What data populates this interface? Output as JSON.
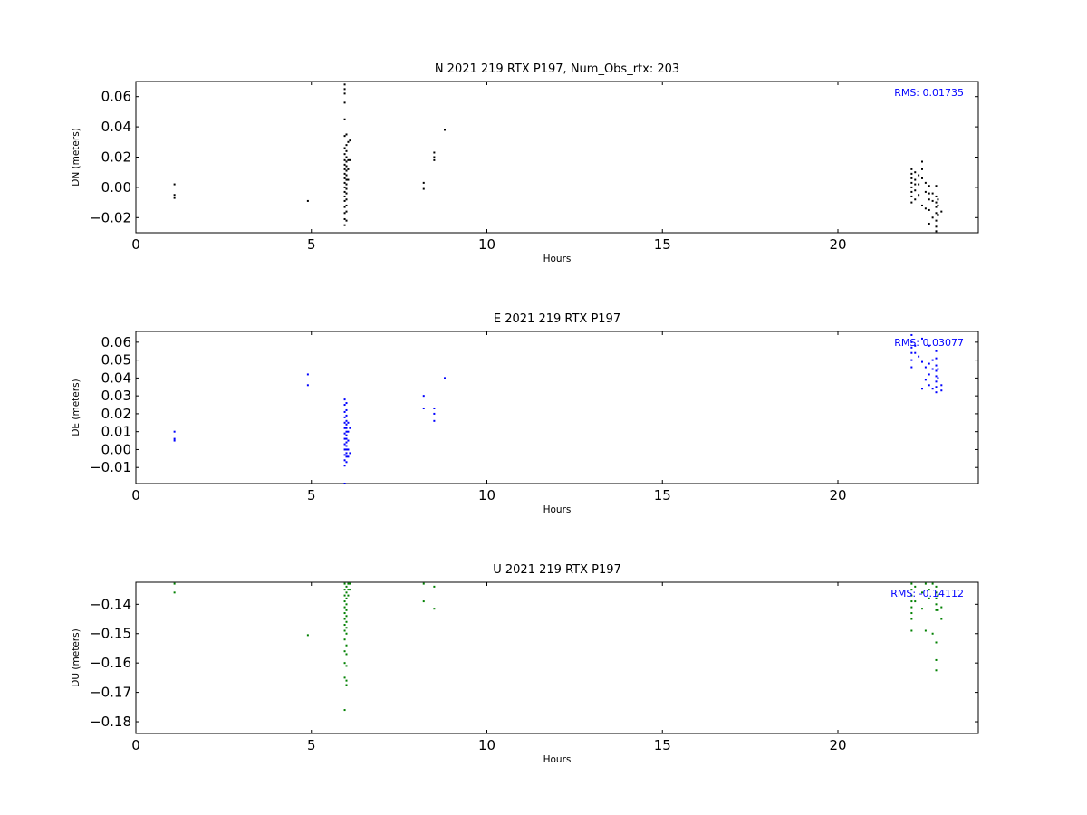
{
  "chart_data": [
    {
      "type": "scatter",
      "title": "N 2021 219 RTX  P197, Num_Obs_rtx: 203",
      "xlabel": "Hours",
      "ylabel": "DN (meters)",
      "xlim": [
        0,
        24
      ],
      "ylim": [
        -0.03,
        0.07
      ],
      "xticks": [
        0,
        5,
        10,
        15,
        20
      ],
      "yticks": [
        -0.02,
        0.0,
        0.02,
        0.04,
        0.06
      ],
      "ytick_labels": [
        "−0.02",
        "0.00",
        "0.02",
        "0.04",
        "0.06"
      ],
      "color": "#000000",
      "grid": false,
      "annotation": "RMS:  0.01735",
      "points": [
        [
          1.1,
          0.002
        ],
        [
          1.1,
          -0.005
        ],
        [
          1.1,
          -0.007
        ],
        [
          4.9,
          -0.009
        ],
        [
          5.95,
          0.068
        ],
        [
          5.95,
          0.065
        ],
        [
          5.95,
          0.062
        ],
        [
          5.95,
          0.056
        ],
        [
          5.95,
          0.045
        ],
        [
          5.95,
          0.034
        ],
        [
          5.95,
          0.026
        ],
        [
          5.95,
          0.022
        ],
        [
          5.95,
          0.018
        ],
        [
          5.95,
          0.015
        ],
        [
          5.95,
          0.012
        ],
        [
          5.95,
          0.009
        ],
        [
          5.95,
          0.006
        ],
        [
          5.95,
          0.003
        ],
        [
          5.95,
          0.0
        ],
        [
          5.95,
          -0.003
        ],
        [
          5.95,
          -0.006
        ],
        [
          5.95,
          -0.009
        ],
        [
          5.95,
          -0.013
        ],
        [
          5.95,
          -0.017
        ],
        [
          5.95,
          -0.021
        ],
        [
          5.95,
          -0.025
        ],
        [
          6.0,
          0.035
        ],
        [
          6.0,
          0.028
        ],
        [
          6.0,
          0.024
        ],
        [
          6.0,
          0.02
        ],
        [
          6.0,
          0.017
        ],
        [
          6.0,
          0.014
        ],
        [
          6.0,
          0.011
        ],
        [
          6.0,
          0.008
        ],
        [
          6.0,
          0.005
        ],
        [
          6.0,
          0.002
        ],
        [
          6.0,
          -0.001
        ],
        [
          6.0,
          -0.004
        ],
        [
          6.0,
          -0.008
        ],
        [
          6.0,
          -0.012
        ],
        [
          6.0,
          -0.016
        ],
        [
          6.0,
          -0.022
        ],
        [
          6.05,
          0.03
        ],
        [
          6.05,
          0.018
        ],
        [
          6.05,
          0.012
        ],
        [
          6.05,
          0.005
        ],
        [
          6.1,
          0.031
        ],
        [
          6.1,
          0.018
        ],
        [
          8.2,
          0.003
        ],
        [
          8.2,
          -0.001
        ],
        [
          8.5,
          0.023
        ],
        [
          8.5,
          0.02
        ],
        [
          8.5,
          0.018
        ],
        [
          8.8,
          0.038
        ],
        [
          22.1,
          0.012
        ],
        [
          22.1,
          0.009
        ],
        [
          22.1,
          0.006
        ],
        [
          22.1,
          0.003
        ],
        [
          22.1,
          0.0
        ],
        [
          22.1,
          -0.003
        ],
        [
          22.1,
          -0.006
        ],
        [
          22.1,
          -0.01
        ],
        [
          22.2,
          0.01
        ],
        [
          22.2,
          0.005
        ],
        [
          22.2,
          0.002
        ],
        [
          22.2,
          -0.002
        ],
        [
          22.2,
          -0.008
        ],
        [
          22.3,
          0.008
        ],
        [
          22.3,
          0.002
        ],
        [
          22.3,
          -0.005
        ],
        [
          22.4,
          0.017
        ],
        [
          22.4,
          0.012
        ],
        [
          22.4,
          0.006
        ],
        [
          22.4,
          -0.012
        ],
        [
          22.5,
          0.003
        ],
        [
          22.5,
          -0.003
        ],
        [
          22.5,
          -0.014
        ],
        [
          22.6,
          0.001
        ],
        [
          22.6,
          -0.004
        ],
        [
          22.6,
          -0.008
        ],
        [
          22.6,
          -0.015
        ],
        [
          22.6,
          -0.024
        ],
        [
          22.7,
          -0.004
        ],
        [
          22.7,
          -0.009
        ],
        [
          22.7,
          -0.02
        ],
        [
          22.8,
          0.001
        ],
        [
          22.8,
          -0.006
        ],
        [
          22.8,
          -0.01
        ],
        [
          22.8,
          -0.013
        ],
        [
          22.8,
          -0.017
        ],
        [
          22.8,
          -0.022
        ],
        [
          22.8,
          -0.026
        ],
        [
          22.8,
          -0.029
        ],
        [
          22.85,
          -0.008
        ],
        [
          22.85,
          -0.012
        ],
        [
          22.85,
          -0.018
        ],
        [
          22.95,
          -0.016
        ]
      ]
    },
    {
      "type": "scatter",
      "title": "E 2021 219 RTX  P197",
      "xlabel": "Hours",
      "ylabel": "DE (meters)",
      "xlim": [
        0,
        24
      ],
      "ylim": [
        -0.019,
        0.066
      ],
      "xticks": [
        0,
        5,
        10,
        15,
        20
      ],
      "yticks": [
        -0.01,
        0.0,
        0.01,
        0.02,
        0.03,
        0.04,
        0.05,
        0.06
      ],
      "ytick_labels": [
        "−0.01",
        "0.00",
        "0.01",
        "0.02",
        "0.03",
        "0.04",
        "0.05",
        "0.06"
      ],
      "color": "#0000ff",
      "grid": false,
      "annotation": "RMS:  0.03077",
      "points": [
        [
          1.1,
          0.01
        ],
        [
          1.1,
          0.006
        ],
        [
          1.1,
          0.005
        ],
        [
          4.9,
          0.042
        ],
        [
          4.9,
          0.036
        ],
        [
          5.95,
          0.028
        ],
        [
          5.95,
          0.025
        ],
        [
          5.95,
          0.021
        ],
        [
          5.95,
          0.018
        ],
        [
          5.95,
          0.015
        ],
        [
          5.95,
          0.012
        ],
        [
          5.95,
          0.009
        ],
        [
          5.95,
          0.006
        ],
        [
          5.95,
          0.003
        ],
        [
          5.95,
          0.0
        ],
        [
          5.95,
          -0.003
        ],
        [
          5.95,
          -0.006
        ],
        [
          5.95,
          -0.009
        ],
        [
          5.95,
          -0.019
        ],
        [
          6.0,
          0.026
        ],
        [
          6.0,
          0.022
        ],
        [
          6.0,
          0.019
        ],
        [
          6.0,
          0.016
        ],
        [
          6.0,
          0.014
        ],
        [
          6.0,
          0.012
        ],
        [
          6.0,
          0.01
        ],
        [
          6.0,
          0.008
        ],
        [
          6.0,
          0.006
        ],
        [
          6.0,
          0.004
        ],
        [
          6.0,
          0.002
        ],
        [
          6.0,
          0.0
        ],
        [
          6.0,
          -0.002
        ],
        [
          6.0,
          -0.004
        ],
        [
          6.0,
          -0.007
        ],
        [
          6.05,
          0.015
        ],
        [
          6.05,
          0.01
        ],
        [
          6.05,
          0.005
        ],
        [
          6.05,
          0.0
        ],
        [
          6.05,
          -0.004
        ],
        [
          6.1,
          0.012
        ],
        [
          6.1,
          -0.002
        ],
        [
          8.2,
          0.03
        ],
        [
          8.2,
          0.023
        ],
        [
          8.5,
          0.023
        ],
        [
          8.5,
          0.02
        ],
        [
          8.5,
          0.016
        ],
        [
          8.8,
          0.04
        ],
        [
          22.1,
          0.064
        ],
        [
          22.1,
          0.06
        ],
        [
          22.1,
          0.057
        ],
        [
          22.1,
          0.054
        ],
        [
          22.1,
          0.05
        ],
        [
          22.1,
          0.046
        ],
        [
          22.2,
          0.058
        ],
        [
          22.2,
          0.054
        ],
        [
          22.3,
          0.052
        ],
        [
          22.4,
          0.062
        ],
        [
          22.4,
          0.049
        ],
        [
          22.4,
          0.034
        ],
        [
          22.5,
          0.046
        ],
        [
          22.5,
          0.039
        ],
        [
          22.6,
          0.058
        ],
        [
          22.6,
          0.048
        ],
        [
          22.6,
          0.042
        ],
        [
          22.6,
          0.036
        ],
        [
          22.7,
          0.05
        ],
        [
          22.7,
          0.045
        ],
        [
          22.7,
          0.034
        ],
        [
          22.8,
          0.055
        ],
        [
          22.8,
          0.051
        ],
        [
          22.8,
          0.047
        ],
        [
          22.8,
          0.044
        ],
        [
          22.8,
          0.041
        ],
        [
          22.8,
          0.038
        ],
        [
          22.8,
          0.035
        ],
        [
          22.8,
          0.032
        ],
        [
          22.85,
          0.045
        ],
        [
          22.85,
          0.04
        ],
        [
          22.95,
          0.036
        ],
        [
          22.95,
          0.033
        ]
      ]
    },
    {
      "type": "scatter",
      "title": "U 2021 219 RTX  P197",
      "xlabel": "Hours",
      "ylabel": "DU (meters)",
      "xlim": [
        0,
        24
      ],
      "ylim": [
        -0.184,
        -0.1325
      ],
      "xticks": [
        0,
        5,
        10,
        15,
        20
      ],
      "yticks": [
        -0.18,
        -0.17,
        -0.16,
        -0.15,
        -0.14
      ],
      "ytick_labels": [
        "−0.18",
        "−0.17",
        "−0.16",
        "−0.15",
        "−0.14"
      ],
      "color": "#008000",
      "grid": false,
      "annotation": "RMS: -0.14112",
      "points": [
        [
          1.1,
          -0.133
        ],
        [
          1.1,
          -0.136
        ],
        [
          4.9,
          -0.1505
        ],
        [
          5.95,
          -0.133
        ],
        [
          5.95,
          -0.135
        ],
        [
          5.95,
          -0.137
        ],
        [
          5.95,
          -0.139
        ],
        [
          5.95,
          -0.141
        ],
        [
          5.95,
          -0.143
        ],
        [
          5.95,
          -0.145
        ],
        [
          5.95,
          -0.147
        ],
        [
          5.95,
          -0.149
        ],
        [
          5.95,
          -0.152
        ],
        [
          5.95,
          -0.156
        ],
        [
          5.95,
          -0.16
        ],
        [
          5.95,
          -0.165
        ],
        [
          5.95,
          -0.176
        ],
        [
          6.0,
          -0.134
        ],
        [
          6.0,
          -0.136
        ],
        [
          6.0,
          -0.138
        ],
        [
          6.0,
          -0.14
        ],
        [
          6.0,
          -0.142
        ],
        [
          6.0,
          -0.144
        ],
        [
          6.0,
          -0.146
        ],
        [
          6.0,
          -0.148
        ],
        [
          6.0,
          -0.15
        ],
        [
          6.0,
          -0.154
        ],
        [
          6.0,
          -0.157
        ],
        [
          6.0,
          -0.161
        ],
        [
          6.0,
          -0.166
        ],
        [
          6.0,
          -0.1675
        ],
        [
          6.05,
          -0.133
        ],
        [
          6.05,
          -0.135
        ],
        [
          6.05,
          -0.137
        ],
        [
          6.1,
          -0.133
        ],
        [
          6.1,
          -0.135
        ],
        [
          8.2,
          -0.133
        ],
        [
          8.2,
          -0.139
        ],
        [
          8.5,
          -0.134
        ],
        [
          8.5,
          -0.1415
        ],
        [
          22.1,
          -0.133
        ],
        [
          22.1,
          -0.135
        ],
        [
          22.1,
          -0.137
        ],
        [
          22.1,
          -0.139
        ],
        [
          22.1,
          -0.141
        ],
        [
          22.1,
          -0.143
        ],
        [
          22.1,
          -0.145
        ],
        [
          22.1,
          -0.149
        ],
        [
          22.2,
          -0.134
        ],
        [
          22.2,
          -0.139
        ],
        [
          22.4,
          -0.136
        ],
        [
          22.4,
          -0.1415
        ],
        [
          22.5,
          -0.133
        ],
        [
          22.5,
          -0.149
        ],
        [
          22.6,
          -0.135
        ],
        [
          22.6,
          -0.138
        ],
        [
          22.7,
          -0.133
        ],
        [
          22.7,
          -0.15
        ],
        [
          22.8,
          -0.134
        ],
        [
          22.8,
          -0.136
        ],
        [
          22.8,
          -0.138
        ],
        [
          22.8,
          -0.14
        ],
        [
          22.8,
          -0.142
        ],
        [
          22.8,
          -0.153
        ],
        [
          22.8,
          -0.159
        ],
        [
          22.8,
          -0.1625
        ],
        [
          22.85,
          -0.137
        ],
        [
          22.85,
          -0.142
        ],
        [
          22.95,
          -0.141
        ],
        [
          22.95,
          -0.145
        ]
      ]
    }
  ]
}
